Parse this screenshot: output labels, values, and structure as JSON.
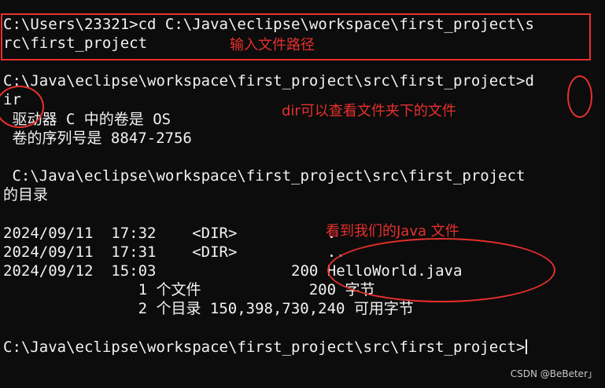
{
  "terminal": {
    "lines": [
      "C:\\Users\\23321>cd C:\\Java\\eclipse\\workspace\\first_project\\s",
      "rc\\first_project",
      "",
      "C:\\Java\\eclipse\\workspace\\first_project\\src\\first_project>d",
      "ir",
      " 驱动器 C 中的卷是 OS",
      " 卷的序列号是 8847-2756",
      "",
      " C:\\Java\\eclipse\\workspace\\first_project\\src\\first_project",
      "的目录",
      "",
      "2024/09/11  17:32    <DIR>          .",
      "2024/09/11  17:31    <DIR>          ..",
      "2024/09/12  15:03               200 HelloWorld.java",
      "               1 个文件            200 字节",
      "               2 个目录 150,398,730,240 可用字节",
      "",
      "C:\\Java\\eclipse\\workspace\\first_project\\src\\first_project>"
    ]
  },
  "annotations": {
    "path_note": "输入文件路径",
    "dir_note": "dir可以查看文件夹下的文件",
    "java_note": "看到我们的Java 文件"
  },
  "watermark": "CSDN @BeBeter」",
  "colors": {
    "background": "#0c0c0c",
    "text": "#f2f2f2",
    "annotation": "#e8302c"
  }
}
